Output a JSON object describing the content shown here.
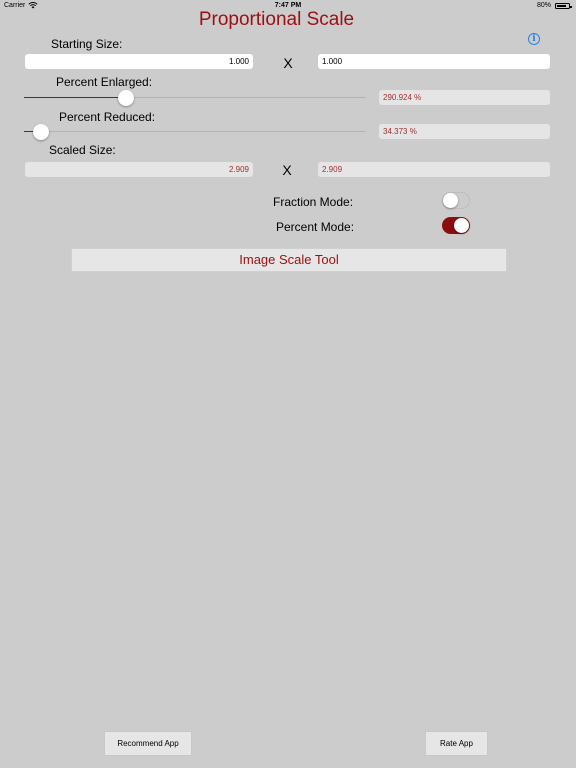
{
  "status_bar": {
    "carrier": "Carrier",
    "time": "7:47 PM",
    "battery_percent": "80%"
  },
  "header": {
    "title": "Proportional Scale",
    "info_icon": "info-icon",
    "info_symbol": "i"
  },
  "starting_size": {
    "label": "Starting Size:",
    "width_value": "1.000",
    "height_value": "1.000",
    "separator": "X"
  },
  "percent_enlarged": {
    "label": "Percent Enlarged:",
    "value_text": "290.924 %",
    "slider_level": 0.3
  },
  "percent_reduced": {
    "label": "Percent Reduced:",
    "value_text": "34.373 %",
    "slider_level": 0.05
  },
  "scaled_size": {
    "label": "Scaled Size:",
    "width_value": "2.909",
    "height_value": "2.909",
    "separator": "X"
  },
  "modes": {
    "fraction_label": "Fraction Mode:",
    "fraction_on": false,
    "percent_label": "Percent Mode:",
    "percent_on": true
  },
  "image_scale_tool": {
    "label": "Image Scale Tool"
  },
  "footer": {
    "recommend_label": "Recommend App",
    "rate_label": "Rate App"
  },
  "colors": {
    "accent": "#9b1010",
    "background": "#cccccc",
    "info_blue": "#2f7fe0"
  }
}
